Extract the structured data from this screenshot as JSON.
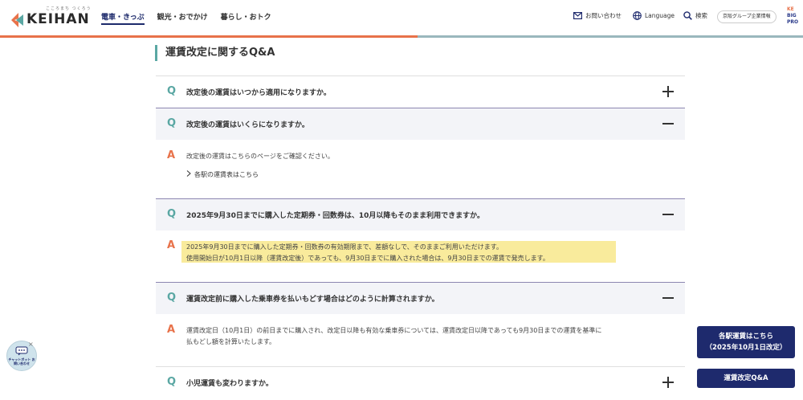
{
  "header": {
    "logo_tagline": "こころまち つくろう",
    "logo_text": "KEIHAN",
    "nav": [
      "電車・きっぷ",
      "観光・おでかけ",
      "暮らし・おトク"
    ],
    "contact": "お問い合わせ",
    "language": "Language",
    "search": "検索",
    "corporate": "京阪グループ企業情報",
    "brand_chip": [
      "KE",
      "BIG",
      "PRO"
    ]
  },
  "section": {
    "title": "運賃改定に関するQ&A"
  },
  "faq": {
    "q_mark": "Q",
    "a_mark": "A",
    "items": [
      {
        "question": "改定後の運賃はいつから適用になりますか。",
        "open": false
      },
      {
        "question": "改定後の運賃はいくらになりますか。",
        "open": true,
        "answer_lines": [
          "改定後の運賃はこちらのページをご確認ください。"
        ],
        "link": "各駅の運賃表はこちら"
      },
      {
        "question": "2025年9月30日までに購入した定期券・回数券は、10月以降もそのまま利用できますか。",
        "open": true,
        "answer_lines": [
          "2025年9月30日までに購入した定期券・回数券の有効期限まで、差額なしで、そのままご利用いただけます。",
          "使用開始日が10月1日以降（運賃改定後）であっても、9月30日までに購入された場合は、9月30日までの運賃で発売します。"
        ]
      },
      {
        "question": "運賃改定前に購入した乗車券を払いもどす場合はどのように計算されますか。",
        "open": true,
        "answer_lines": [
          "運賃改定日（10月1日）の前日までに購入され、改定日以降も有効な乗車券については、運賃改定日以降であっても9月30日までの運賃を基準に",
          "払もどし額を計算いたします。"
        ]
      },
      {
        "question": "小児運賃も変わりますか。",
        "open": false
      }
    ]
  },
  "floating": {
    "fare_button": [
      "各駅運賃はこちら",
      "（2025年10月1日改定）"
    ],
    "qa_button": "運賃改定Q&A",
    "chatbot": "チャットボット お問い合わせ",
    "chatbot_close": "×"
  },
  "colors": {
    "navy": "#1e2a6d",
    "teal": "#5aa7a3",
    "orange": "#e8724a",
    "highlight": "#f9eb9c"
  },
  "icons": [
    "mail-icon",
    "globe-icon",
    "search-icon",
    "chevron-right-icon",
    "plus-icon",
    "minus-icon",
    "chat-icon"
  ]
}
